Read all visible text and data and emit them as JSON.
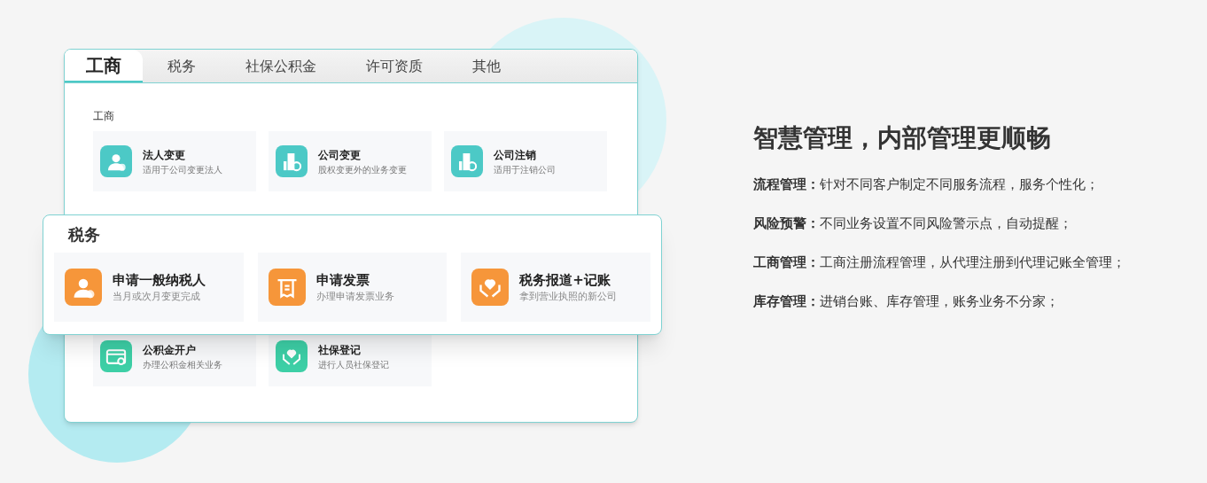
{
  "panel": {
    "tabs": [
      {
        "label": "工商",
        "selected": true
      },
      {
        "label": "税务",
        "selected": false
      },
      {
        "label": "社保公积金",
        "selected": false
      },
      {
        "label": "许可资质",
        "selected": false
      },
      {
        "label": "其他",
        "selected": false
      }
    ],
    "sections": [
      {
        "title": "工商",
        "color": "#4cc9c6",
        "items": [
          {
            "title": "法人变更",
            "subtitle": "适用于公司变更法人",
            "kind": "person"
          },
          {
            "title": "公司变更",
            "subtitle": "股权变更外的业务变更",
            "kind": "building"
          },
          {
            "title": "公司注销",
            "subtitle": "适用于注销公司",
            "kind": "building"
          }
        ]
      },
      {
        "color": "#3dcfa6",
        "items": [
          {
            "title": "公积金开户",
            "subtitle": "办理公积金相关业务",
            "kind": "card"
          },
          {
            "title": "社保登记",
            "subtitle": "进行人员社保登记",
            "kind": "hands"
          }
        ]
      }
    ]
  },
  "popup": {
    "title": "税务",
    "color": "#f6963a",
    "items": [
      {
        "title": "申请一般纳税人",
        "subtitle": "当月或次月变更完成",
        "kind": "person"
      },
      {
        "title": "申请发票",
        "subtitle": "办理申请发票业务",
        "kind": "receipt"
      },
      {
        "title": "税务报道+记账",
        "subtitle": "拿到营业执照的新公司",
        "kind": "hands"
      }
    ]
  },
  "feature": {
    "title": "智慧管理，内部管理更顺畅",
    "points": [
      "**流程管理：**针对不同客户制定不同服务流程，服务个性化；",
      "**风险预警：**不同业务设置不同风险警示点，自动提醒；",
      "**工商管理：**工商注册流程管理，从代理注册到代理记账全管理；",
      "**库存管理：**进销台账、库存管理，账务业务不分家；"
    ]
  }
}
